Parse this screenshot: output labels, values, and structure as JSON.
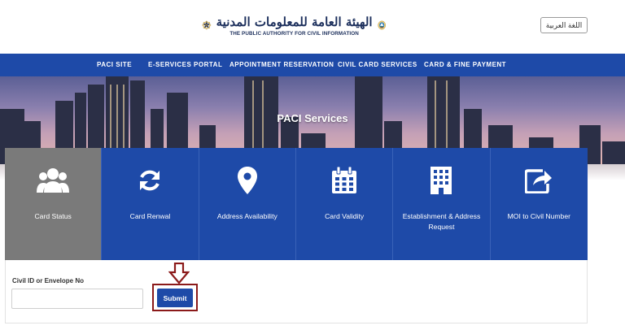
{
  "header": {
    "logo_ar": "الهيئة العامة للمعلومات المدنية",
    "logo_en": "THE PUBLIC AUTHORITY FOR CIVIL INFORMATION",
    "lang_button": "اللغة العربية"
  },
  "nav": [
    {
      "label": "PACI SITE"
    },
    {
      "label": "E-SERVICES PORTAL"
    },
    {
      "label": "APPOINTMENT RESERVATION"
    },
    {
      "label": "CIVIL CARD SERVICES"
    },
    {
      "label": "CARD & FINE PAYMENT"
    }
  ],
  "hero": {
    "title": "PACI Services"
  },
  "services": [
    {
      "label": "Card Status",
      "icon": "users-icon",
      "active": true
    },
    {
      "label": "Card Renwal",
      "icon": "refresh-icon",
      "active": false
    },
    {
      "label": "Address Availability",
      "icon": "map-pin-icon",
      "active": false
    },
    {
      "label": "Card Validity",
      "icon": "calendar-icon",
      "active": false
    },
    {
      "label": "Establishment & Address Request",
      "icon": "building-icon",
      "active": false
    },
    {
      "label": "MOI to Civil Number",
      "icon": "share-icon",
      "active": false
    }
  ],
  "form": {
    "label": "Civil ID or Envelope No",
    "input_value": "",
    "input_placeholder": "",
    "submit_label": "Submit"
  },
  "colors": {
    "brand_blue": "#1e4aa8",
    "active_card": "#7a7a7a",
    "highlight": "#8b1a1a"
  }
}
